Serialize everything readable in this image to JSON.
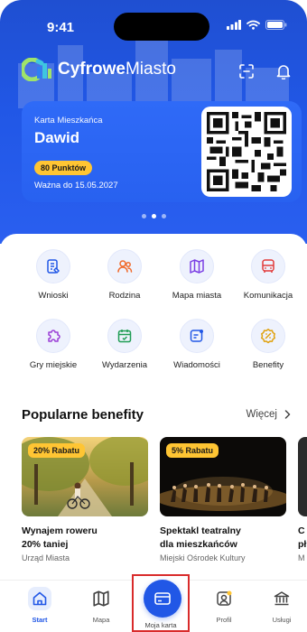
{
  "status": {
    "time": "9:41"
  },
  "brand": {
    "name_bold": "Cyfrowe",
    "name_light": "Miasto"
  },
  "card": {
    "label": "Karta Mieszkańca",
    "name": "Dawid",
    "points": "80 Punktów",
    "valid": "Ważna do 15.05.2027"
  },
  "tiles": [
    {
      "label": "Wnioski",
      "icon": "document-icon"
    },
    {
      "label": "Rodzina",
      "icon": "family-icon"
    },
    {
      "label": "Mapa miasta",
      "icon": "map-icon"
    },
    {
      "label": "Komunikacja",
      "icon": "bus-icon"
    },
    {
      "label": "Gry miejskie",
      "icon": "puzzle-icon"
    },
    {
      "label": "Wydarzenia",
      "icon": "calendar-icon"
    },
    {
      "label": "Wiadomości",
      "icon": "message-icon"
    },
    {
      "label": "Benefity",
      "icon": "discount-icon"
    }
  ],
  "benefits": {
    "title": "Popularne benefity",
    "more": "Więcej",
    "items": [
      {
        "tag": "20% Rabatu",
        "title_line1": "Wynajem roweru",
        "title_line2": "20% taniej",
        "org": "Urząd Miasta"
      },
      {
        "tag": "5% Rabatu",
        "title_line1": "Spektakl teatralny",
        "title_line2": "dla mieszkańców",
        "org": "Miejski Ośrodek Kultury"
      },
      {
        "tag": "",
        "title_line1": "C",
        "title_line2": "pł",
        "org": "M"
      }
    ]
  },
  "nav": [
    {
      "label": "Start",
      "icon": "home-icon",
      "active": true
    },
    {
      "label": "Mapa",
      "icon": "map-icon"
    },
    {
      "label": "Moja karta",
      "icon": "card-icon"
    },
    {
      "label": "Profil",
      "icon": "profile-icon"
    },
    {
      "label": "Usługi",
      "icon": "institution-icon"
    }
  ],
  "colors": {
    "primary": "#2157e6",
    "accent": "#ffc533",
    "highlight_border": "#d92b2b"
  }
}
